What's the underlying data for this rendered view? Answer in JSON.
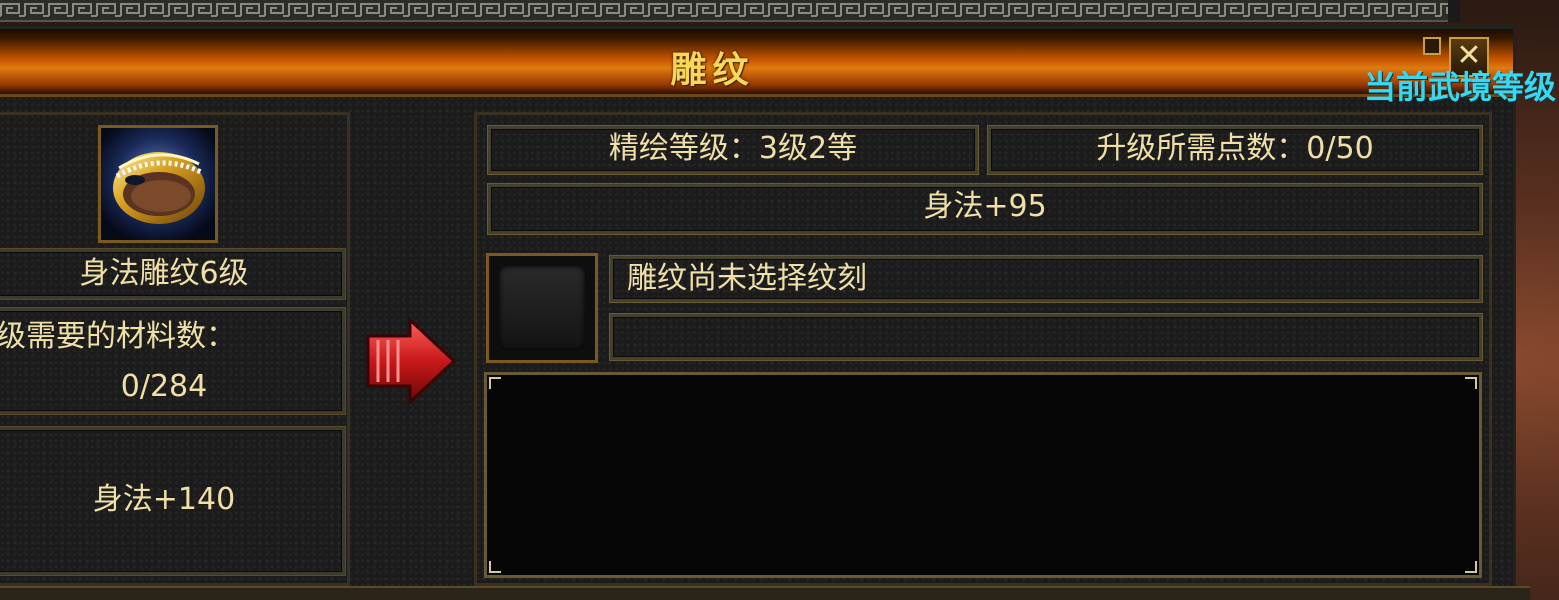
{
  "window": {
    "title": "雕纹",
    "close_icon": "close-icon",
    "pin_icon": "pin-icon"
  },
  "wujing_label": "当前武境等级",
  "left": {
    "item_icon": "ring-icon",
    "item_name": "身法雕纹6级",
    "material_label": "升级需要的材料数：",
    "material_count": "0/284",
    "bonus": "身法+140"
  },
  "arrow_icon": "right-arrow-icon",
  "right": {
    "level_label": "精绘等级：3级2等",
    "points_label": "升级所需点数：0/50",
    "bonus": "身法+95",
    "engrave_status": "雕纹尚未选择纹刻",
    "engrave_detail": "",
    "description": ""
  },
  "colors": {
    "title_gold": "#f8d858",
    "body_text": "#f0e0a8",
    "cyan_label": "#38d8f0",
    "arrow_red": "#c82020"
  }
}
